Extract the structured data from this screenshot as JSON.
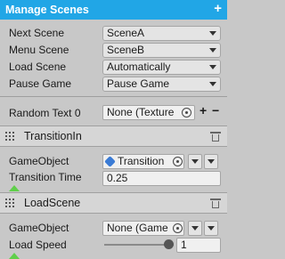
{
  "header": {
    "title": "Manage Scenes",
    "add_label": "+"
  },
  "settings": {
    "next_scene": {
      "label": "Next Scene",
      "value": "SceneA"
    },
    "menu_scene": {
      "label": "Menu Scene",
      "value": "SceneB"
    },
    "load_scene": {
      "label": "Load Scene",
      "value": "Automatically"
    },
    "pause_game": {
      "label": "Pause Game",
      "value": "Pause Game"
    }
  },
  "random_row": {
    "label": "Random  Text 0",
    "value": "None (Texture",
    "plus_label": "+",
    "minus_label": "−"
  },
  "transition_in": {
    "title": "TransitionIn",
    "gameobject_label": "GameObject",
    "gameobject_value": "Transition",
    "time_label": "Transition Time",
    "time_value": "0.25"
  },
  "load_scene_section": {
    "title": "LoadScene",
    "gameobject_label": "GameObject",
    "gameobject_value": "None (Game",
    "speed_label": "Load Speed",
    "speed_value": "1",
    "speed_slider_fraction": 1.0
  },
  "colors": {
    "header": "#21a6e6",
    "add_marker": "#5fcf4a"
  }
}
